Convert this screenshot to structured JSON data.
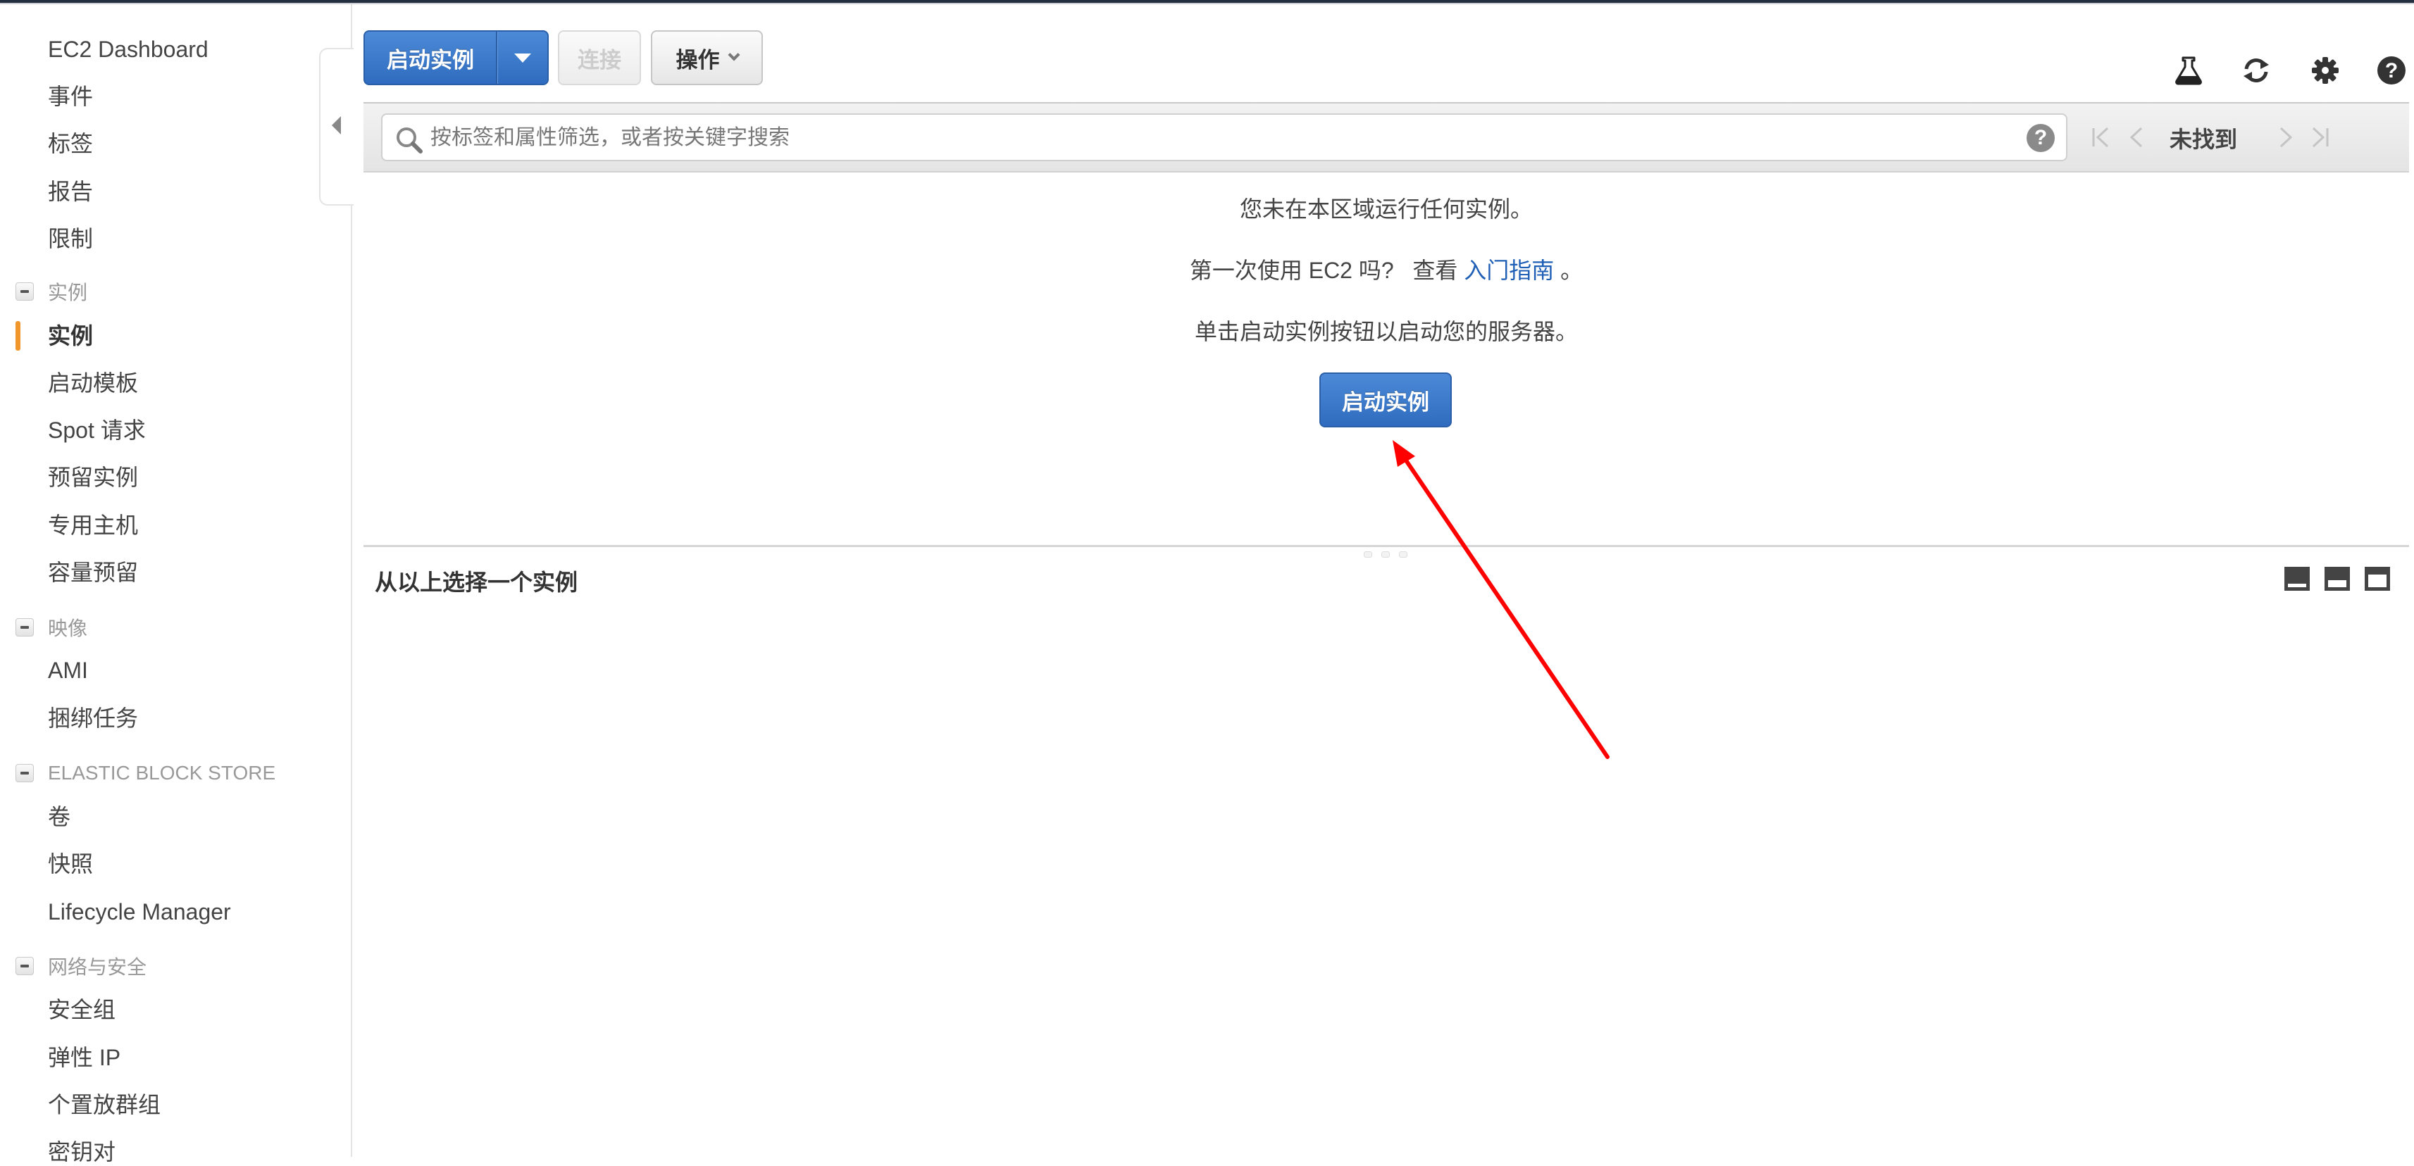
{
  "sidebar": {
    "top_items": [
      {
        "label": "EC2 Dashboard"
      },
      {
        "label": "事件"
      },
      {
        "label": "标签"
      },
      {
        "label": "报告"
      },
      {
        "label": "限制"
      }
    ],
    "groups": [
      {
        "label": "实例",
        "expanded": true,
        "items": [
          {
            "label": "实例",
            "active": true
          },
          {
            "label": "启动模板"
          },
          {
            "label": "Spot 请求"
          },
          {
            "label": "预留实例"
          },
          {
            "label": "专用主机"
          },
          {
            "label": "容量预留"
          }
        ]
      },
      {
        "label": "映像",
        "expanded": true,
        "items": [
          {
            "label": "AMI"
          },
          {
            "label": "捆绑任务"
          }
        ]
      },
      {
        "label": "ELASTIC BLOCK STORE",
        "expanded": true,
        "items": [
          {
            "label": "卷"
          },
          {
            "label": "快照"
          },
          {
            "label": "Lifecycle Manager"
          }
        ]
      },
      {
        "label": "网络与安全",
        "expanded": true,
        "items": [
          {
            "label": "安全组"
          },
          {
            "label": "弹性 IP"
          },
          {
            "label": "个置放群组"
          },
          {
            "label": "密钥对"
          }
        ]
      }
    ],
    "active_indicator_color": "#f0962b"
  },
  "toolbar": {
    "launch_label": "启动实例",
    "connect_label": "连接",
    "actions_label": "操作",
    "icons": [
      "flask-icon",
      "refresh-icon",
      "gear-icon",
      "help-icon"
    ]
  },
  "filter": {
    "placeholder": "按标签和属性筛选，或者按关键字搜索",
    "value": "",
    "help_glyph": "?",
    "pager_status": "未找到"
  },
  "empty_state": {
    "line1": "您未在本区域运行任何实例。",
    "line2_prefix": "第一次使用 EC2 吗?   查看 ",
    "line2_link": "入门指南",
    "line2_suffix": " 。",
    "line3": "单击启动实例按钮以启动您的服务器。",
    "button_label": "启动实例"
  },
  "detail_panel": {
    "title": "从以上选择一个实例"
  },
  "colors": {
    "primary": "#2f6cbf",
    "link": "#1f5fb5",
    "annotation_arrow": "#ff0000"
  }
}
